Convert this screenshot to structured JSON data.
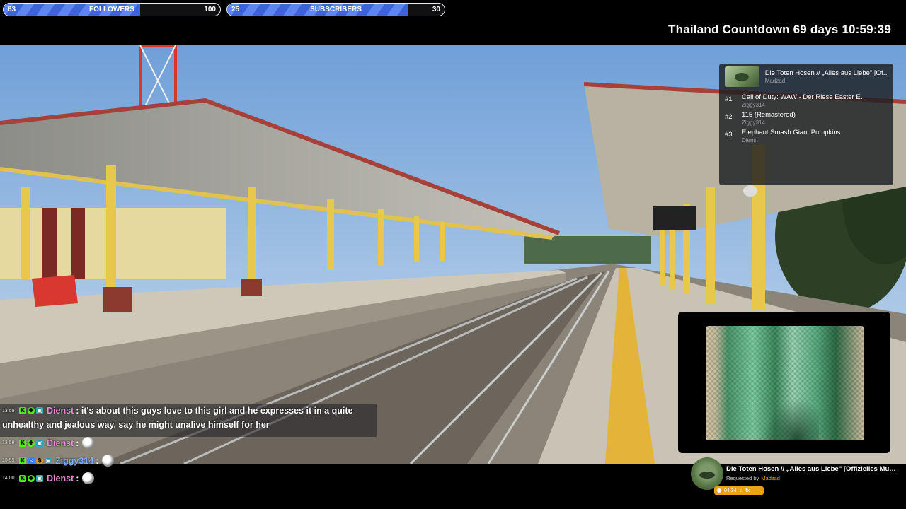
{
  "goals": {
    "followers": {
      "current": "63",
      "label": "FOLLOWERS",
      "target": "100",
      "progress": 0.63
    },
    "subscribers": {
      "current": "25",
      "label": "SUBSCRIBERS",
      "target": "30",
      "progress": 0.83
    }
  },
  "countdown": {
    "text": "Thailand Countdown 69 days 10:59:39"
  },
  "queue": {
    "now": {
      "title": "Die Toten Hosen // „Alles aus Liebe\" [Offizielles Musikvideo]",
      "requester": "Madzad"
    },
    "items": [
      {
        "num": "#1",
        "title": "Call of Duty: WAW - Der Riese Easter Egg song",
        "requester": "Ziggy314"
      },
      {
        "num": "#2",
        "title": "115 (Remastered)",
        "requester": "Ziggy314"
      },
      {
        "num": "#3",
        "title": "Elephant Smash Giant Pumpkins",
        "requester": "Dienst"
      }
    ]
  },
  "chat": {
    "messages": [
      {
        "time": "13:59",
        "user": "Dienst",
        "text": ": it's about this guys love to this girl and he expresses it in a quite",
        "cont": "unhealthy and jealous way. say he might unalive himself for her"
      },
      {
        "time": "13:59",
        "user": "Dienst",
        "text": ":"
      },
      {
        "time": "13:59",
        "user": "Ziggy314",
        "text": ":"
      },
      {
        "time": "14:00",
        "user": "Dienst",
        "text": ":"
      }
    ]
  },
  "now_playing": {
    "title": "Die Toten Hosen // „Alles aus Liebe\" [Offizielles Musikvideo]",
    "requested_by": "Requested by",
    "requester": "Madzad",
    "duration": "04:34",
    "plays": "♫ 4x"
  },
  "colors": {
    "accent": "#e8a317",
    "goal_fill": "#4a72e6",
    "dienst": "#e889d6",
    "ziggy": "#7fb0ff"
  }
}
